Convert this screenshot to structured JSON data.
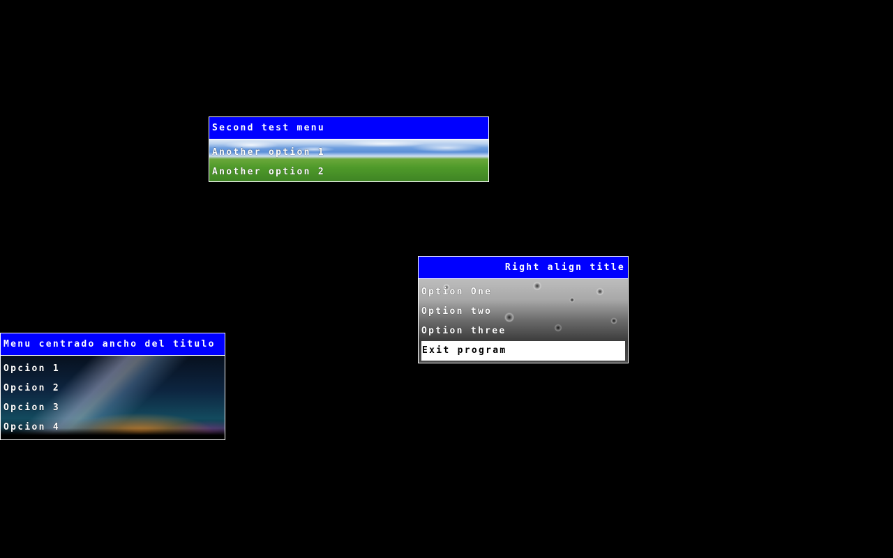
{
  "menus": {
    "second": {
      "title": "Second test menu",
      "items": [
        "Another option 1",
        "Another option 2"
      ]
    },
    "right": {
      "title": "Right align title",
      "items": [
        "Option One",
        "Option two",
        "Option three",
        "Exit program"
      ],
      "selected_item": "Exit program"
    },
    "centered": {
      "title": "Menu centrado ancho del titulo",
      "items": [
        "Opcion 1",
        "Opcion 2",
        "Opcion 3",
        "Opcion 4"
      ]
    }
  },
  "colors": {
    "background": "#000000",
    "title_bar": "#0000ff",
    "border": "#ffffff",
    "text": "#ffffff",
    "selected_background": "#ffffff",
    "selected_text": "#000000"
  }
}
